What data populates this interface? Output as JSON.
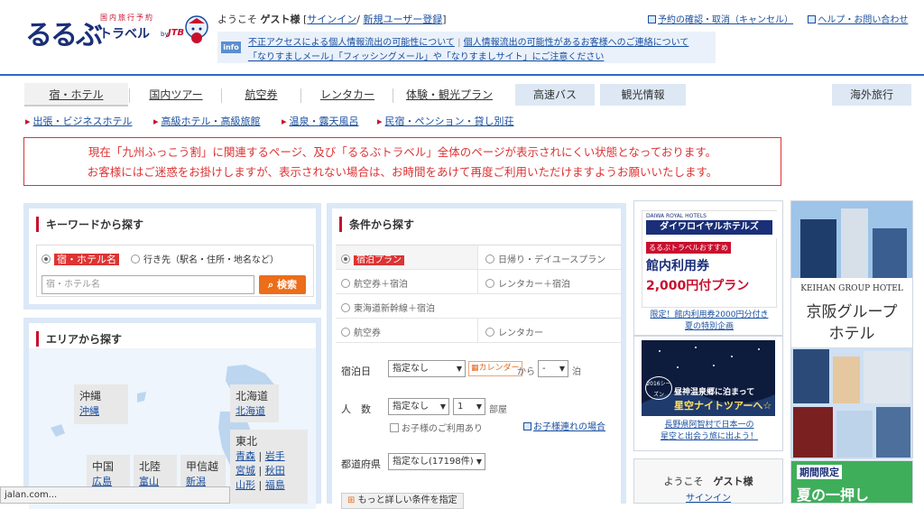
{
  "header": {
    "logo_text": "るるぶ",
    "logo_sub": "国内旅行予約",
    "logo_travel": "トラベル",
    "logo_by": "by",
    "logo_jtb": "JTB",
    "welcome_prefix": "ようこそ",
    "welcome_user": "ゲスト様",
    "login_link": "サインイン",
    "register_link": "新規ユーザー登録",
    "reservation_link": "予約の確認・取消（キャンセル）",
    "help_link": "ヘルプ・お問い合わせ",
    "info_label": "info",
    "info_link1": "不正アクセスによる個人情報流出の可能性について",
    "info_link2": "個人情報流出の可能性があるお客様へのご連絡について",
    "info_line2": "「なりすましメール」「フィッシングメール」や「なりすましサイト」にご注意ください"
  },
  "nav": {
    "tabs": [
      "宿・ホテル",
      "国内ツアー",
      "航空券",
      "レンタカー",
      "体験・観光プラン"
    ],
    "blue_tabs": [
      "高速バス",
      "観光情報"
    ],
    "overseas": "海外旅行"
  },
  "subnav": [
    "出張・ビジネスホテル",
    "高級ホテル・高級旅館",
    "温泉・露天風呂",
    "民宿・ペンション・貸し別荘"
  ],
  "notice": {
    "line1": "現在「九州ふっこう割」に関連するページ、及び「るるぶトラベル」全体のページが表示されにくい状態となっております。",
    "line2": "お客様にはご迷惑をお掛けしますが、表示されない場合は、お時間をあけて再度ご利用いただけますようお願いいたします。"
  },
  "keyword": {
    "title": "キーワードから探す",
    "opt1": "宿・ホテル名",
    "opt2": "行き先（駅名・住所・地名など）",
    "placeholder": "宿・ホテル名",
    "search_btn": "検索"
  },
  "area": {
    "title": "エリアから探す",
    "okinawa": "沖縄",
    "okinawa_link": "沖縄",
    "hokkaido": "北海道",
    "hokkaido_link": "北海道",
    "tohoku": "東北",
    "tohoku_links": [
      "青森",
      "岩手",
      "宮城",
      "秋田",
      "山形",
      "福島"
    ],
    "chugoku": "中国",
    "chugoku_link": "広島",
    "hokuriku": "北陸",
    "hokuriku_link": "富山",
    "koshinetsu": "甲信越",
    "koshinetsu_link": "新潟"
  },
  "conditions": {
    "title": "条件から探す",
    "options": [
      "宿泊プラン",
      "日帰り・デイユースプラン",
      "航空券＋宿泊",
      "レンタカー＋宿泊",
      "東海道新幹線＋宿泊",
      "航空券",
      "レンタカー"
    ],
    "stay_date_label": "宿泊日",
    "stay_date_value": "指定なし",
    "calendar": "カレンダー",
    "from": "から",
    "nights_value": "-",
    "nights_unit": "泊",
    "people_label": "人　数",
    "people_value": "指定なし",
    "rooms_value": "1",
    "rooms_unit": "部屋",
    "children": "お子様のご利用あり",
    "children_link": "お子様連れの場合",
    "pref_label": "都道府県",
    "pref_value": "指定なし(17198件)",
    "more_btn": "もっと詳しい条件を指定"
  },
  "ads": {
    "daiwa_brand": "DAIWA ROYAL HOTELS",
    "daiwa_name": "ダイワロイヤルホテルズ",
    "daiwa_tag": "るるぶトラベルおすすめ",
    "daiwa_title": "館内利用券",
    "daiwa_price": "2,000円付プラン",
    "daiwa_link": "限定！館内利用券2000円分付き",
    "daiwa_link2": "夏の特別企画",
    "night_year": "2016シーズン",
    "night_text1": "昼神温泉郷に泊まって",
    "night_text2": "星空ナイトツアーへ☆",
    "night_link": "長野県阿智村で日本一の",
    "night_link2": "星空と出会う旅に出よう！",
    "keihan_en": "KEIHAN GROUP HOTEL",
    "keihan_jp1": "京阪グループ",
    "keihan_jp2": "ホテル",
    "welcome2": "ようこそ",
    "welcome2_user": "ゲスト様",
    "signin2": "サインイン",
    "limited": "期間限定",
    "summer": "夏の一押し"
  },
  "status_bar": "jalan.com..."
}
